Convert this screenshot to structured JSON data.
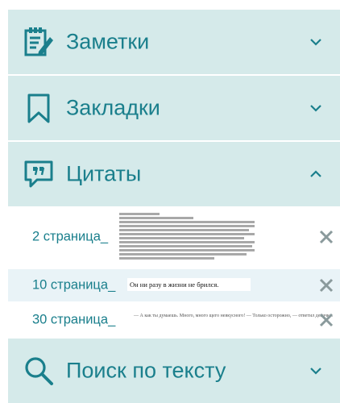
{
  "sections": {
    "notes": {
      "label": "Заметки",
      "icon": "notes-edit-icon",
      "expanded": false
    },
    "bookmarks": {
      "label": "Закладки",
      "icon": "bookmark-icon",
      "expanded": false
    },
    "quotes": {
      "label": "Цитаты",
      "icon": "quote-bubble-icon",
      "expanded": true
    },
    "search": {
      "label": "Поиск по тексту",
      "icon": "search-icon",
      "expanded": false
    }
  },
  "quotes": [
    {
      "page": "2 страница",
      "snippet": ""
    },
    {
      "page": "10 страница",
      "snippet": "Он ни разу в жизни не брился."
    },
    {
      "page": "30 страница",
      "snippet": "— А как ты думаешь. Много, много щего невкусного! — Только осторожно, — ответил девочка."
    }
  ],
  "colors": {
    "accent": "#1a7f8c",
    "header_bg": "#d5eaea",
    "selected_row_bg": "#e9f3f7",
    "close_icon": "#8a9a9c"
  }
}
